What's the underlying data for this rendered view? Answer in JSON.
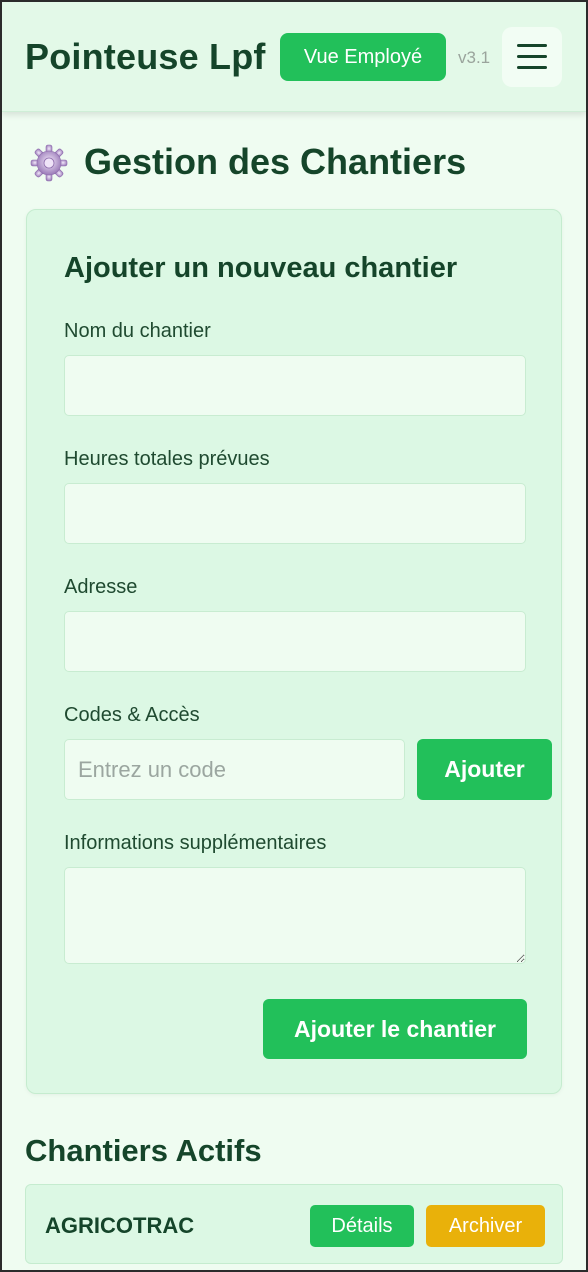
{
  "header": {
    "app_title": "Pointeuse Lpf",
    "view_button": "Vue Employé",
    "version": "v3.1"
  },
  "page": {
    "title": "Gestion des Chantiers",
    "title_icon": "gear-icon"
  },
  "form": {
    "title": "Ajouter un nouveau chantier",
    "name_label": "Nom du chantier",
    "name_value": "",
    "hours_label": "Heures totales prévues",
    "hours_value": "",
    "address_label": "Adresse",
    "address_value": "",
    "codes_label": "Codes & Accès",
    "code_placeholder": "Entrez un code",
    "code_add_button": "Ajouter",
    "info_label": "Informations supplémentaires",
    "info_value": "",
    "submit_button": "Ajouter le chantier"
  },
  "active_sites": {
    "title": "Chantiers Actifs",
    "items": [
      {
        "name": "AGRICOTRAC",
        "details_button": "Détails",
        "archive_button": "Archiver"
      }
    ]
  },
  "colors": {
    "primary_green": "#22c05a",
    "archive_yellow": "#e9b10a",
    "text_dark_green": "#15452a",
    "background": "#effcf1"
  }
}
